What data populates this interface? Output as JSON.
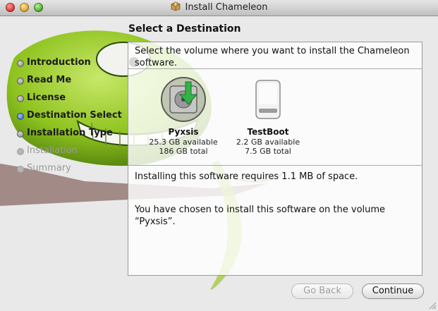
{
  "window": {
    "title": "Install Chameleon",
    "controls": [
      "close",
      "minimize",
      "zoom"
    ]
  },
  "page": {
    "heading": "Select a Destination",
    "intro": "Select the volume where you want to install the Chameleon software."
  },
  "steps": [
    {
      "label": "Introduction",
      "state": "done"
    },
    {
      "label": "Read Me",
      "state": "done"
    },
    {
      "label": "License",
      "state": "done"
    },
    {
      "label": "Destination Select",
      "state": "current"
    },
    {
      "label": "Installation Type",
      "state": "done"
    },
    {
      "label": "Installation",
      "state": "pending"
    },
    {
      "label": "Summary",
      "state": "pending"
    }
  ],
  "volumes": [
    {
      "name": "Pyxsis",
      "available": "25.3 GB available",
      "total": "186 GB total",
      "selected": true,
      "icon": "hard-drive-selected-icon"
    },
    {
      "name": "TestBoot",
      "available": "2.2 GB available",
      "total": "7.5 GB total",
      "selected": false,
      "icon": "external-drive-icon"
    }
  ],
  "messages": {
    "space": "Installing this software requires 1.1 MB of space.",
    "chosen": "You have chosen to install this software on the volume “Pyxsis”."
  },
  "buttons": {
    "back": "Go Back",
    "continue": "Continue"
  },
  "colors": {
    "accent": "#2c5fb6",
    "chameleon": "#8fc31f",
    "selection_arrow": "#33b248"
  }
}
